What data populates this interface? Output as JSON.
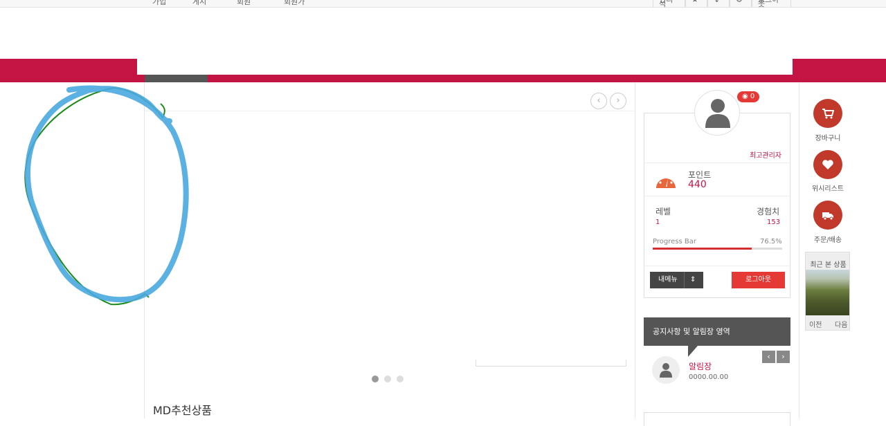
{
  "topbar": {
    "left_items": [
      "가입",
      "게시",
      "회원",
      "회원가"
    ],
    "right_items": [
      "편리석",
      "★",
      "↓",
      "⚙",
      "로그아웃"
    ]
  },
  "slider": {
    "prev_icon": "chevron-left-icon",
    "next_icon": "chevron-right-icon",
    "dot_count": 3,
    "active_dot": 0
  },
  "section": {
    "title": "MD추천상품"
  },
  "profile": {
    "badge_count": "0",
    "role": "최고관리자",
    "point_label": "포인트",
    "point_value": "440",
    "level_label": "레벨",
    "level_value": "1",
    "exp_label": "경험치",
    "exp_value": "153",
    "progress_label": "Progress Bar",
    "progress_text": "76.5%",
    "progress_value": 76.5,
    "menu_label": "내메뉴",
    "logout_label": "로그아웃"
  },
  "notice": {
    "header": "공지사항 및 알림장 영역",
    "title": "알림장",
    "date": "0000.00.00"
  },
  "quick": {
    "cart_label": "장바구니",
    "wish_label": "위시리스트",
    "order_label": "주문/배송",
    "recent_title": "최근 본 상품",
    "recent_prev": "이전",
    "recent_next": "다음"
  },
  "colors": {
    "brand": "#c41444",
    "accent_red": "#e53935",
    "dark_gray": "#555555",
    "quick_red": "#c0392b",
    "doodle_blue": "#4aa8e0",
    "doodle_green": "#1a8a1a"
  }
}
